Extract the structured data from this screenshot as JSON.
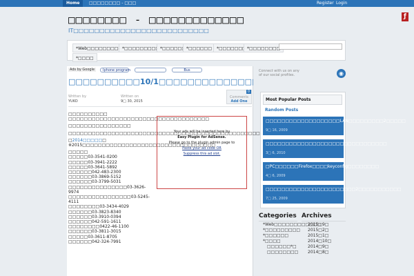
{
  "topbar": {
    "home": "Home",
    "item2": "□□□□□□□□ - □□□",
    "register": "Register",
    "login": "Login"
  },
  "site": {
    "title": "□□□□□□□□ - □□□□□□□□□□□□□",
    "description": "IT□□□□□□□□□□□□□□□□□□□□□□□□□□"
  },
  "nav": [
    "*Web□□□□□□□□□□□□",
    "*□□□□□□□□□",
    "*□□□□□□",
    "*□□□□□□",
    "*□□□□□□□",
    "*□□□□□□□□",
    "*□□□□"
  ],
  "ads": {
    "ads_by": "Ads by Google",
    "link1": "Iphone program",
    "link2": "",
    "link3": "Bus"
  },
  "post": {
    "title": "□□□□□□□□□□10/1□□□□□□□□□□□□□□□□□□□□□□",
    "written_by_label": "Written by",
    "author": "YUKO",
    "written_on_label": "Written on",
    "date": "9□ 30, 2015",
    "comments_label": "Comments",
    "comments_count": "0",
    "add_one": "Add One",
    "paragraphs": [
      "□□□□□□□□□□",
      "□□□□□□□□□□□□□□□□□□□□□□□□□□□□□□□□□□□□",
      "□□□□□□□□□□□□□□□□",
      "□□□□□□□□□□□□□□□□□□□□□□□□□□□□□□□□□□□□□□□□□□□□□□□□□"
    ],
    "link_prefix": "□",
    "link_text": "2014□□□□□",
    "link_suffix": "□",
    "note": "※2015□□□□□□□□□□□□□□□□□□□□□□□□□□□□□□□□□□",
    "list_heading": "□□□□□",
    "phones": [
      "□□□□□03-3541-0200",
      "□□□□□03-3941-2222",
      "□□□□□03-3641-5892",
      "□□□□□□042-483-2300",
      "□□□□□□03-3869-5152",
      "□□□□□□03-3799-5031",
      "□□□□□□□□□□□□□□□03-3626-9974",
      "□□□□□□□□□□□□□□□□03-5245-4111",
      "□□□□□□□□03-3434-4029",
      "□□□□□□03-3823-8340",
      "□□□□□□03-3910-0394",
      "□□□□□□042-591-1611",
      "□□□□□□□□0422-46-1100",
      "□□□□□□03-3811-3015",
      "□□□□□03-3611-8705",
      "□□□□□□042-324-7991"
    ]
  },
  "adbox": {
    "line1": "Your ads will be inserted here by",
    "line2": "Easy Plugin for AdSense.",
    "line3": "Please go to the plugin admin page to",
    "line4": "Paste your ad code OR",
    "line5": "Suppress this ad slot."
  },
  "sidebar": {
    "social": "Connect with us on any of our social profiles.",
    "tab_popular": "Most Popular Posts",
    "tab_random": "Random Posts",
    "random_posts": [
      {
        "title": "□□□□□□□□□□□□□□□□□□□LAN□□□□□□□□□2□□□□□",
        "date": "9□ 16, 2009"
      },
      {
        "title": "□□□□□□□□□□□□□□□□□□□□□□□□□□□□□□□",
        "date": "3□ 6, 2010"
      },
      {
        "title": "□PC□□□□□□Firefox□□□□keyconfig□□□□□□□□",
        "date": "4□ 6, 2009"
      },
      {
        "title": "□□□□□□□□□□□□□□□□□□□□□□□2□□□□□□□□□□□",
        "date": "7□ 25, 2009"
      }
    ],
    "categories_title": "Categories",
    "archives_title": "Archives",
    "categories": [
      "*Web□□□□□□□□□□□□",
      "*□□□□□□□□□",
      "*□□□□□□",
      "*□□□□",
      "□□□□□□*□",
      "□□□□□□□□"
    ],
    "archives": [
      "2015□9□",
      "2015□2□",
      "2015□1□",
      "2014□10□",
      "2014□9□",
      "2014□8□"
    ]
  }
}
